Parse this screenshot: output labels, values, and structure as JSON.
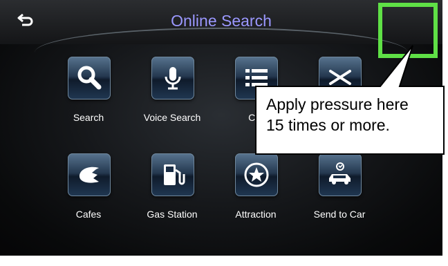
{
  "header": {
    "title": "Online Search"
  },
  "tiles": [
    {
      "label": "Search"
    },
    {
      "label": "Voice Search"
    },
    {
      "label": "Cat"
    },
    {
      "label": ""
    },
    {
      "label": "Cafes"
    },
    {
      "label": "Gas Station"
    },
    {
      "label": "Attraction"
    },
    {
      "label": "Send to Car"
    }
  ],
  "callout": {
    "line1": "Apply pressure here",
    "line2": "15 times or more."
  },
  "colors": {
    "title": "#9b98ff",
    "highlight": "#5fe046",
    "tile_top": "#58748f",
    "tile_bottom": "#203752"
  },
  "icons": [
    "back-arrow-icon",
    "magnifier-icon",
    "microphone-icon",
    "list-icon",
    "fork-knife-icon",
    "croissant-icon",
    "fuel-pump-icon",
    "star-icon",
    "car-icon"
  ]
}
